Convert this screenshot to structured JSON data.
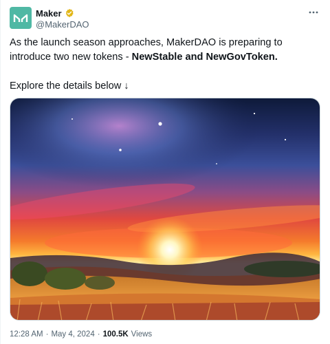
{
  "author": {
    "display_name": "Maker",
    "handle": "@MakerDAO",
    "verified_badge_icon": "gold-verified-badge-icon",
    "avatar_icon": "maker-logo-icon",
    "avatar_color": "#4fb8a4"
  },
  "more_icon": "more-horizontal-icon",
  "text": {
    "line1": "As the launch season approaches, MakerDAO is preparing to introduce two new tokens - ",
    "highlight": "NewStable and NewGovToken.",
    "line2": "Explore the details below ↓"
  },
  "media": {
    "image_icon": "sunset-landscape-image"
  },
  "meta": {
    "time": "12:28 AM",
    "separator": "·",
    "date": "May 4, 2024",
    "separator2": "·",
    "views_count": "100.5K",
    "views_label": "Views"
  },
  "colors": {
    "text": "#0f1419",
    "secondary": "#536471",
    "border": "#cfd9de",
    "badge_gold": "#e2b719"
  }
}
